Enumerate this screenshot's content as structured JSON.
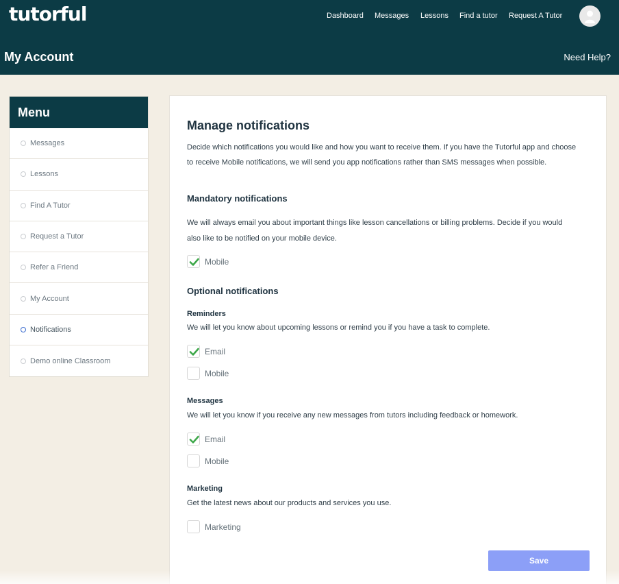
{
  "header": {
    "logo": "tutorful",
    "nav": [
      {
        "label": "Dashboard"
      },
      {
        "label": "Messages"
      },
      {
        "label": "Lessons"
      },
      {
        "label": "Find a tutor"
      },
      {
        "label": "Request A Tutor"
      }
    ],
    "page_title": "My Account",
    "help_link": "Need Help?"
  },
  "sidebar": {
    "title": "Menu",
    "items": [
      {
        "label": "Messages",
        "active": false
      },
      {
        "label": "Lessons",
        "active": false
      },
      {
        "label": "Find A Tutor",
        "active": false
      },
      {
        "label": "Request a Tutor",
        "active": false
      },
      {
        "label": "Refer a Friend",
        "active": false
      },
      {
        "label": "My Account",
        "active": false
      },
      {
        "label": "Notifications",
        "active": true
      },
      {
        "label": "Demo online Classroom",
        "active": false
      }
    ]
  },
  "main": {
    "title": "Manage notifications",
    "intro_line1": "Decide which notifications you would like and how you want to receive them. If you have the Tutorful app and choose",
    "intro_line2": "to receive Mobile notifications, we will send you app notifications rather than SMS messages when possible.",
    "mandatory": {
      "title": "Mandatory notifications",
      "desc_line1": "We will always email you about important things like lesson cancellations or billing problems. Decide if you would",
      "desc_line2": "also like to be notified on your mobile device.",
      "mobile": {
        "label": "Mobile",
        "checked": true
      }
    },
    "optional": {
      "title": "Optional notifications",
      "reminders": {
        "title": "Reminders",
        "desc": "We will let you know about upcoming lessons or remind you if you have a task to complete.",
        "email": {
          "label": "Email",
          "checked": true
        },
        "mobile": {
          "label": "Mobile",
          "checked": false
        }
      },
      "messages": {
        "title": "Messages",
        "desc": "We will let you know if you receive any new messages from tutors including feedback or homework.",
        "email": {
          "label": "Email",
          "checked": true
        },
        "mobile": {
          "label": "Mobile",
          "checked": false
        }
      },
      "marketing": {
        "title": "Marketing",
        "desc": "Get the latest news about our products and services you use.",
        "marketing": {
          "label": "Marketing",
          "checked": false
        }
      }
    },
    "save_label": "Save"
  },
  "colors": {
    "header_bg": "#0c3b45",
    "page_bg": "#f3eee4",
    "check_green": "#3ea84a",
    "save_button": "#8c9ff7"
  }
}
